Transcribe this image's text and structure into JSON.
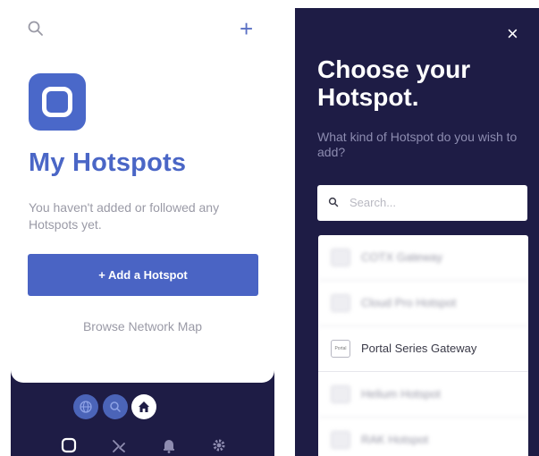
{
  "left": {
    "title": "My Hotspots",
    "description": "You haven't added or followed any Hotspots yet.",
    "add_button": "+ Add a Hotspot",
    "browse_link": "Browse Network Map",
    "plus_label": "+"
  },
  "right": {
    "close_label": "×",
    "heading": "Choose your Hotspot.",
    "question": "What kind of Hotspot do you wish to add?",
    "search_placeholder": "Search...",
    "options": [
      {
        "label": "COTX Gateway",
        "icon_text": "",
        "blurred": true
      },
      {
        "label": "Cloud Pro Hotspot",
        "icon_text": "",
        "blurred": true
      },
      {
        "label": "Portal Series Gateway",
        "icon_text": "Portal",
        "blurred": false
      },
      {
        "label": "Helium Hotspot",
        "icon_text": "",
        "blurred": true
      },
      {
        "label": "RAK Hotspot",
        "icon_text": "",
        "blurred": true
      }
    ]
  },
  "colors": {
    "accent": "#4a66c6",
    "dark_bg": "#1e1c45"
  }
}
